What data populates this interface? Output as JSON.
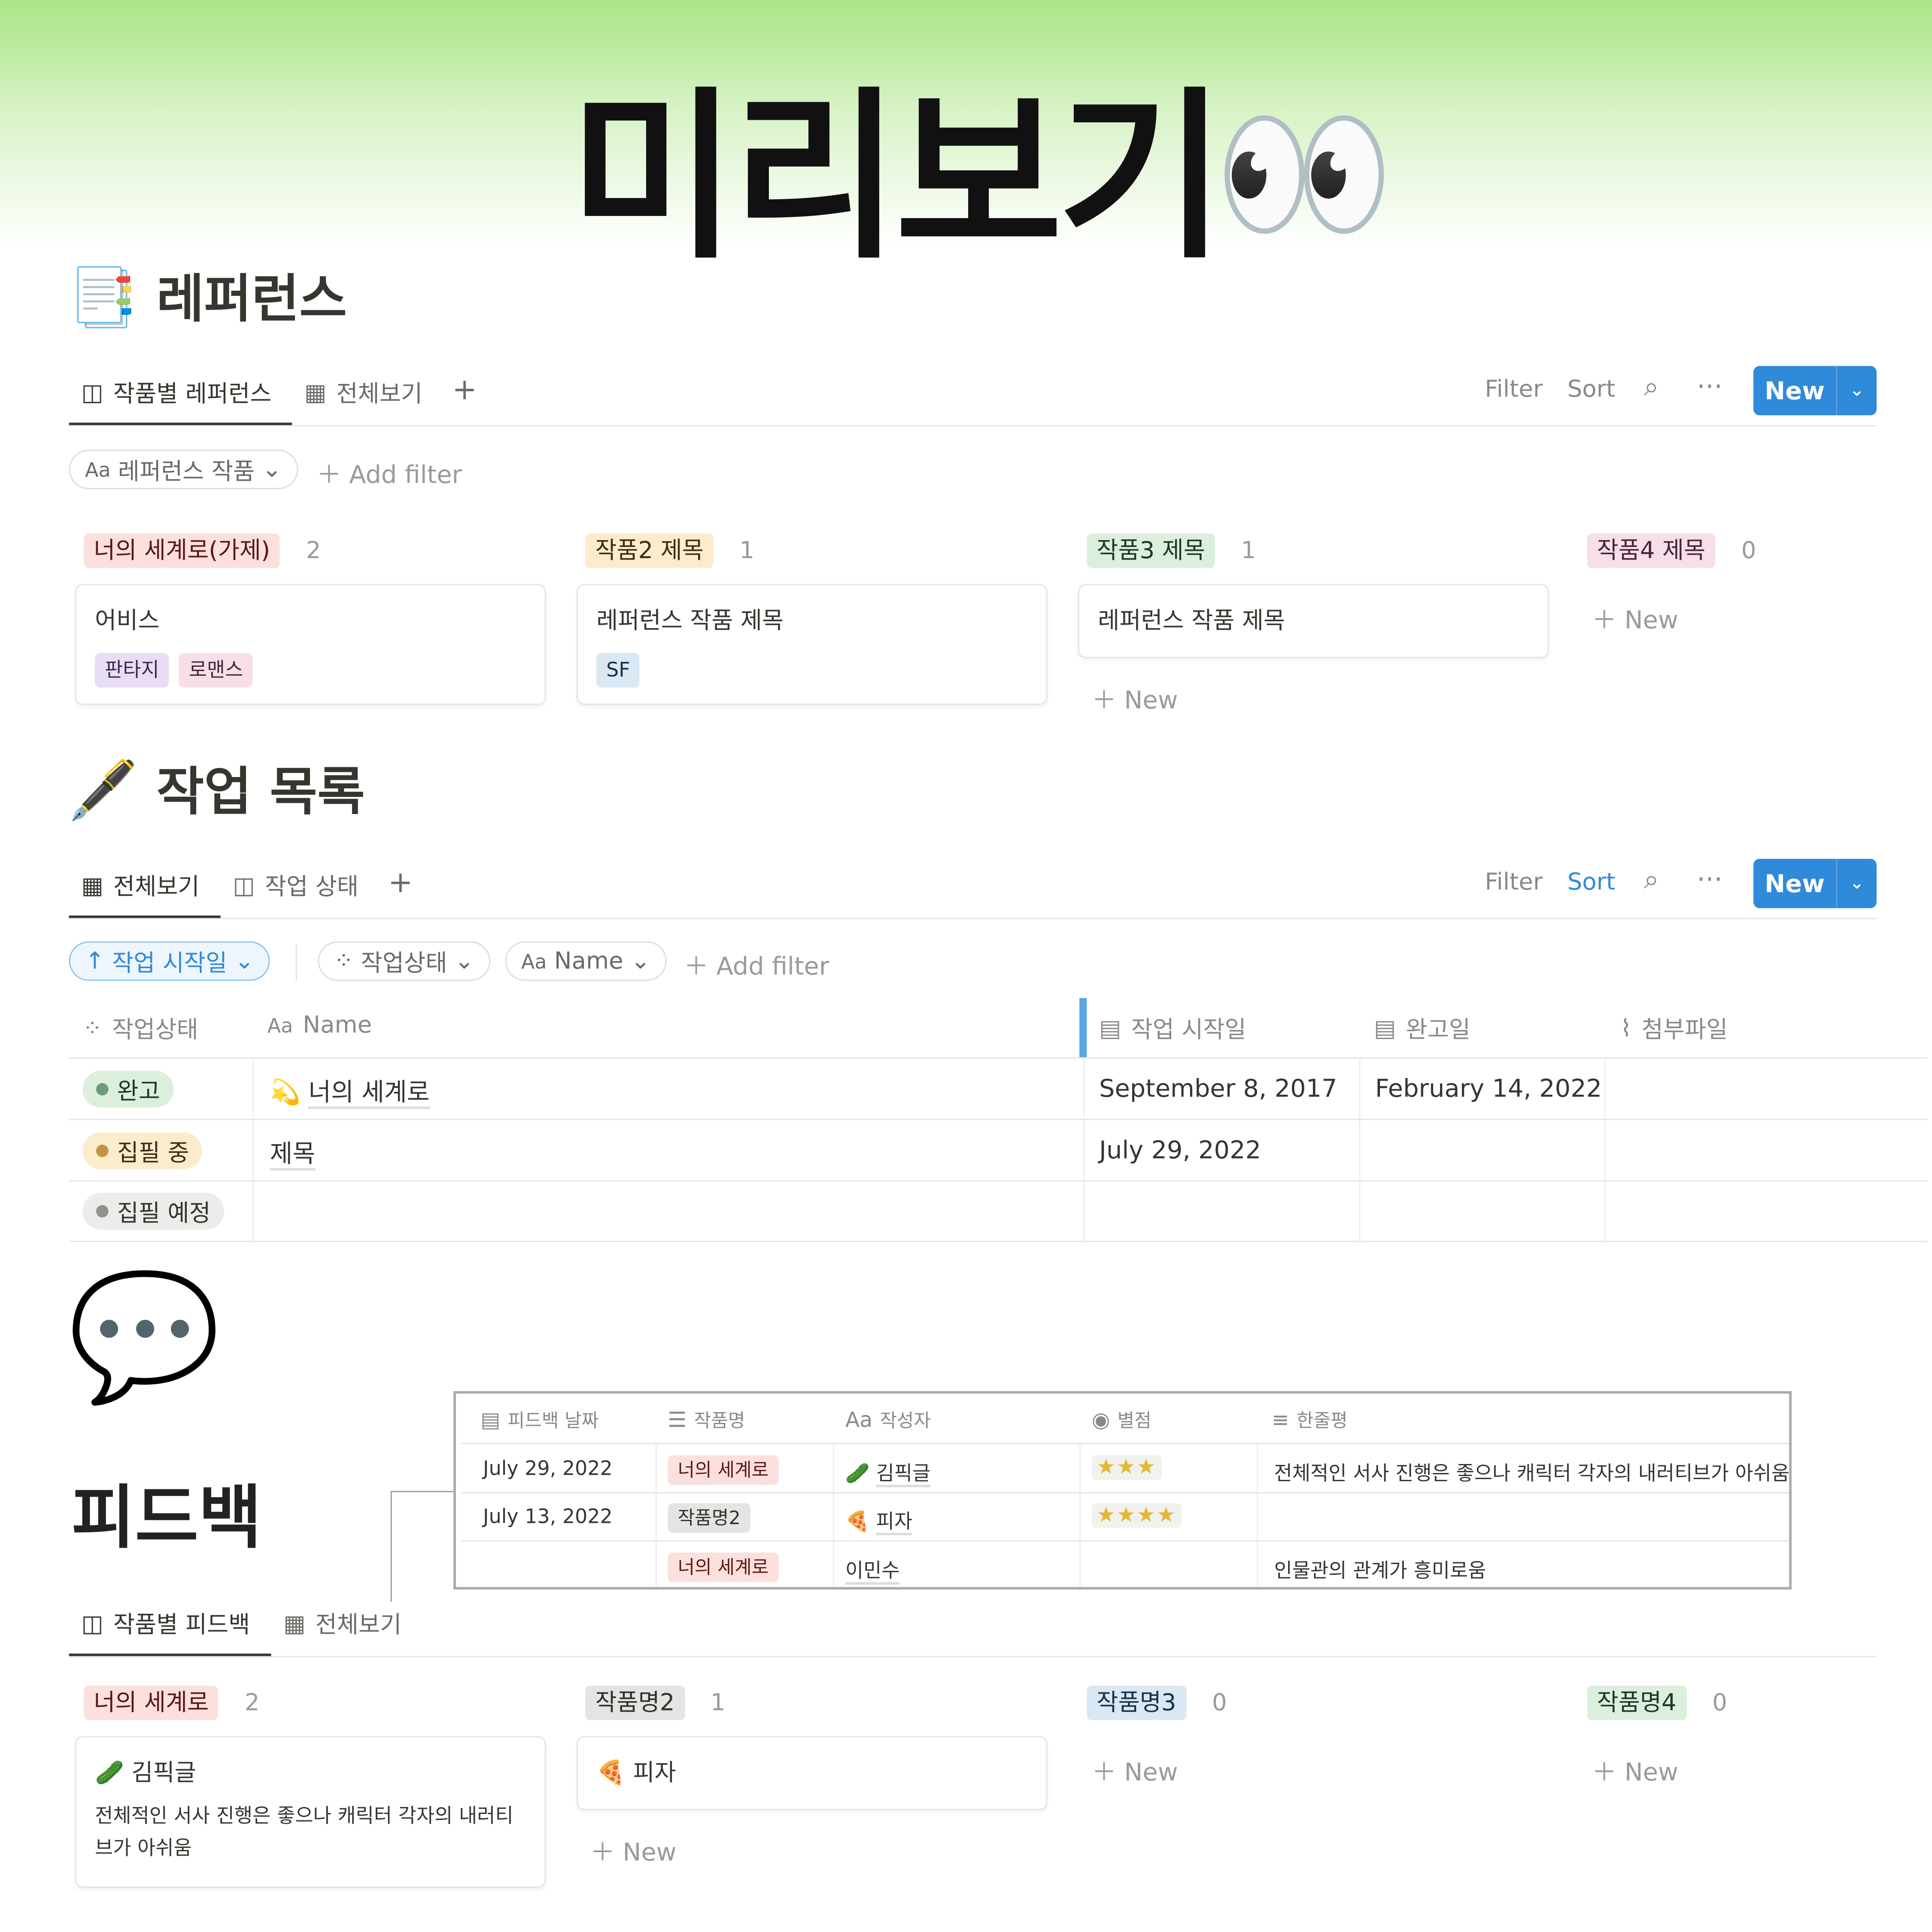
{
  "hero": {
    "title": "미리보기",
    "emoji": "👀"
  },
  "colors": {
    "accent": "#2f8ad9",
    "red_tag": "#fbe0dd",
    "yellow_tag": "#fbeccb",
    "green_tag": "#dcefdd",
    "pink_tag": "#f6dfe8",
    "gray_tag": "#e4e4e2",
    "blue_tag": "#d9e8f3",
    "purple_tag": "#e8def3"
  },
  "reference": {
    "icon": "📑",
    "title": "레퍼런스",
    "tabs": [
      {
        "label": "작품별 레퍼런스",
        "icon": "board-icon"
      },
      {
        "label": "전체보기",
        "icon": "table-icon"
      }
    ],
    "toolbar": {
      "filter": "Filter",
      "sort": "Sort",
      "new": "New"
    },
    "filter_chip": "레퍼런스 작품",
    "add_filter": "Add filter",
    "columns": [
      {
        "label": "너의 세계로(가제)",
        "count": "2",
        "cards": [
          {
            "title": "어비스",
            "tags": [
              "판타지",
              "로맨스"
            ]
          }
        ]
      },
      {
        "label": "작품2 제목",
        "count": "1",
        "cards": [
          {
            "title": "레퍼런스 작품 제목",
            "tags": [
              "SF"
            ]
          }
        ]
      },
      {
        "label": "작품3 제목",
        "count": "1",
        "cards": [
          {
            "title": "레퍼런스 작품 제목"
          }
        ],
        "new": "New"
      },
      {
        "label": "작품4 제목",
        "count": "0",
        "new": "New"
      }
    ]
  },
  "tasks": {
    "icon": "🖋️",
    "title": "작업 목록",
    "tabs": [
      {
        "label": "전체보기",
        "icon": "table-icon"
      },
      {
        "label": "작업 상태",
        "icon": "board-icon"
      }
    ],
    "toolbar": {
      "filter": "Filter",
      "sort": "Sort",
      "new": "New"
    },
    "sort_chip": "작업 시작일",
    "chips": [
      "작업상태",
      "Name"
    ],
    "add_filter": "Add filter",
    "headers": [
      "작업상태",
      "Name",
      "작업 시작일",
      "완고일",
      "첨부파일"
    ],
    "rows": [
      {
        "status": "완고",
        "name": "너의 세계로",
        "name_icon": "💫",
        "start": "September 8, 2017",
        "done": "February 14, 2022"
      },
      {
        "status": "집필 중",
        "name": "제목",
        "start": "July 29, 2022",
        "done": ""
      },
      {
        "status": "집필 예정",
        "name": "",
        "start": "",
        "done": ""
      }
    ]
  },
  "feedback": {
    "icon": "💬",
    "title": "피드백",
    "table": {
      "headers": [
        "피드백 날짜",
        "작품명",
        "작성자",
        "별점",
        "한줄평"
      ],
      "rows": [
        {
          "date": "July 29, 2022",
          "work": "너의 세계로",
          "author": "김픽글",
          "author_icon": "🥒",
          "stars": 3,
          "comment": "전체적인 서사 진행은 좋으나 캐릭터 각자의 내러티브가 아쉬움"
        },
        {
          "date": "July 13, 2022",
          "work": "작품명2",
          "author": "피자",
          "author_icon": "🍕",
          "stars": 4,
          "comment": ""
        },
        {
          "date": "",
          "work": "너의 세계로",
          "author": "이민수",
          "stars": 0,
          "comment": "인물관의 관계가 흥미로움"
        }
      ]
    },
    "tabs": [
      {
        "label": "작품별 피드백",
        "icon": "board-icon"
      },
      {
        "label": "전체보기",
        "icon": "table-icon"
      }
    ],
    "columns": [
      {
        "label": "너의 세계로",
        "count": "2",
        "cards": [
          {
            "icon": "🥒",
            "title": "김픽글",
            "body": "전체적인 서사 진행은 좋으나 캐릭터 각자의 내러티브가 아쉬움"
          }
        ]
      },
      {
        "label": "작품명2",
        "count": "1",
        "cards": [
          {
            "icon": "🍕",
            "title": "피자"
          }
        ],
        "new": "New"
      },
      {
        "label": "작품명3",
        "count": "0",
        "new": "New"
      },
      {
        "label": "작품명4",
        "count": "0",
        "new": "New"
      }
    ]
  }
}
